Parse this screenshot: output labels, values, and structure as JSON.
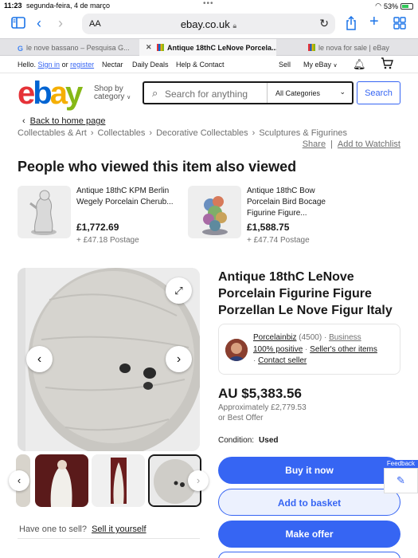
{
  "status_bar": {
    "time": "11:23",
    "date": "segunda-feira, 4 de março",
    "battery": "53%"
  },
  "browser": {
    "url": "ebay.co.uk",
    "aa_label": "AA",
    "tabs": [
      {
        "label": "le nove bassano – Pesquisa G..."
      },
      {
        "label": "Antique 18thC LeNove Porcela..."
      },
      {
        "label": "le nova for sale | eBay"
      }
    ]
  },
  "topnav": {
    "hello": "Hello.",
    "sign_in": "Sign in",
    "or": "or",
    "register": "register",
    "nectar": "Nectar",
    "daily_deals": "Daily Deals",
    "help": "Help & Contact",
    "sell": "Sell",
    "my_ebay": "My eBay"
  },
  "header": {
    "logo_letters": [
      "e",
      "b",
      "a",
      "y"
    ],
    "logo_colors": [
      "#e53238",
      "#0064d2",
      "#f5af02",
      "#86b817"
    ],
    "shop_by_line1": "Shop by",
    "shop_by_line2": "category",
    "search_placeholder": "Search for anything",
    "category": "All Categories",
    "search_button": "Search"
  },
  "nav": {
    "back": "Back to home page",
    "breadcrumbs": [
      "Collectables & Art",
      "Collectables",
      "Decorative Collectables",
      "Sculptures & Figurines"
    ],
    "share": "Share",
    "watchlist": "Add to Watchlist"
  },
  "recommendations": {
    "title": "People who viewed this item also viewed",
    "items": [
      {
        "title": "Antique 18thC KPM Berlin Wegely Porcelain Cherub...",
        "price": "£1,772.69",
        "postage": "+ £47.18 Postage"
      },
      {
        "title": "Antique 18thC Bow Porcelain Bird Bocage Figurine Figure...",
        "price": "£1,588.75",
        "postage": "+ £47.74 Postage"
      }
    ]
  },
  "gallery": {
    "sell_prompt": "Have one to sell?",
    "sell_link": "Sell it yourself"
  },
  "listing": {
    "title": "Antique 18thC LeNove Porcelain Figurine Figure Porzellan Le Nove Figur Italy",
    "seller": {
      "name": "Porcelainbiz",
      "score": "(4500)",
      "type": "Business",
      "positive": "100% positive",
      "other_items": "Seller's other items",
      "contact": "Contact seller"
    },
    "price": "AU $5,383.56",
    "approx": "Approximately £2,779.53",
    "best_offer": "or Best Offer",
    "condition_label": "Condition:",
    "condition_value": "Used",
    "buy_now": "Buy it now",
    "add_basket": "Add to basket",
    "make_offer": "Make offer",
    "feedback": "Feedback"
  }
}
